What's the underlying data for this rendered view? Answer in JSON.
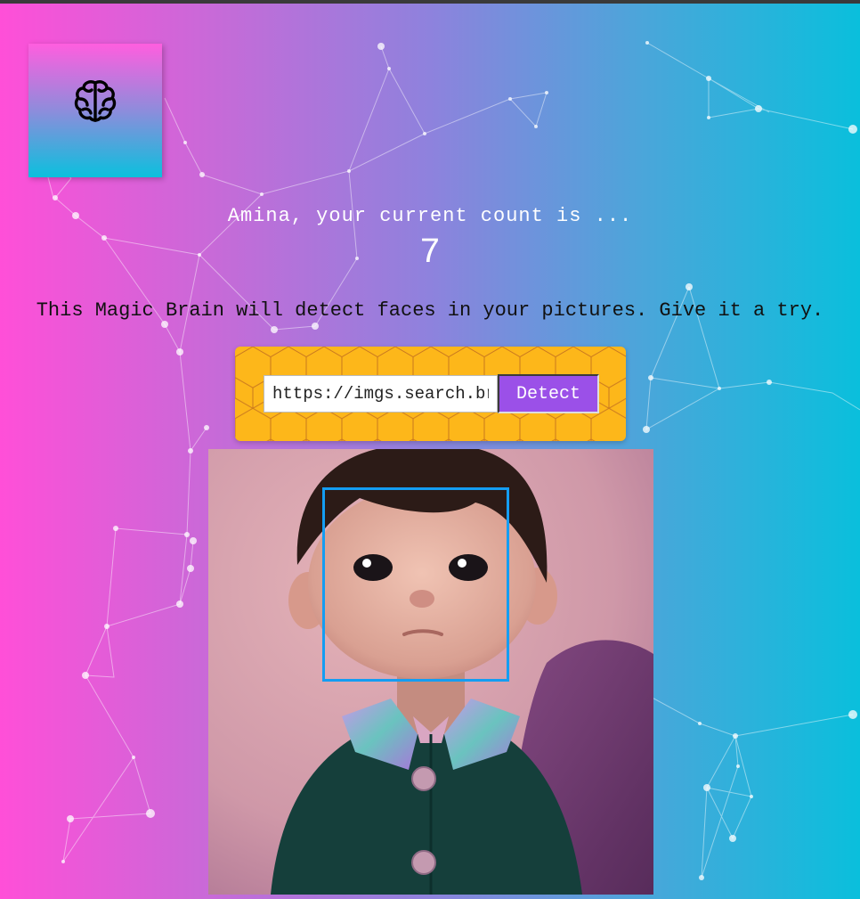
{
  "user": {
    "name_line": "Amina, your current count is ...",
    "entries": "7"
  },
  "intro": {
    "text": "This Magic Brain will detect faces in your pictures. Give it a try."
  },
  "form": {
    "input_value": "https://imgs.search.brave.com/face-image.jpg",
    "button_label": "Detect"
  },
  "logo": {
    "icon": "brain-icon"
  },
  "image": {
    "alt": "cartoon boy",
    "face_boxes": 1
  },
  "colors": {
    "gradient_left": "#ff4fd8",
    "gradient_right": "#0abfdc",
    "panel": "#fdb71a",
    "button": "#9b50e8",
    "face_box": "#149df2"
  }
}
